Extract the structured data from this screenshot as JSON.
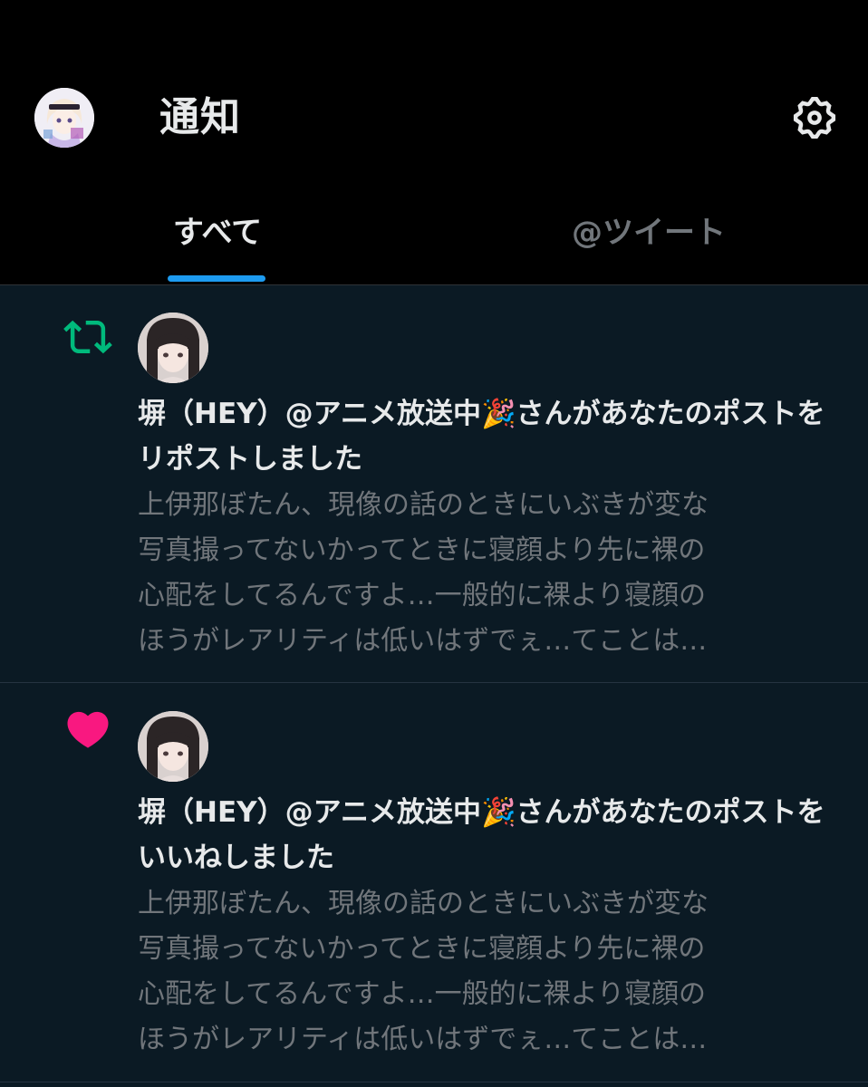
{
  "header": {
    "title": "通知",
    "tabs": [
      {
        "label": "すべて",
        "active": true
      },
      {
        "label": "@ツイート",
        "active": false
      }
    ]
  },
  "notifications": [
    {
      "type": "repost",
      "icon": "repost-icon",
      "headline": "塀（HEY）@アニメ放送中🎉さんがあなたのポストをリポストしました",
      "excerpt": "上伊那ぼたん、現像の話のときにいぶきが変な\n写真撮ってないかってときに寝顔より先に裸の\n心配をしてるんですよ…一般的に裸より寝顔の\nほうがレアリティは低いはずでぇ…てことは…"
    },
    {
      "type": "like",
      "icon": "heart-icon",
      "headline": "塀（HEY）@アニメ放送中🎉さんがあなたのポストをいいねしました",
      "excerpt": "上伊那ぼたん、現像の話のときにいぶきが変な\n写真撮ってないかってときに寝顔より先に裸の\n心配をしてるんですよ…一般的に裸より寝顔の\nほうがレアリティは低いはずでぇ…てことは…"
    }
  ],
  "colors": {
    "background_header": "#000000",
    "background_feed": "#0b1a24",
    "accent": "#1d9bf0",
    "repost": "#00ba7c",
    "like": "#f91880",
    "text_primary": "#e7e9ea",
    "text_secondary": "#71767b"
  }
}
